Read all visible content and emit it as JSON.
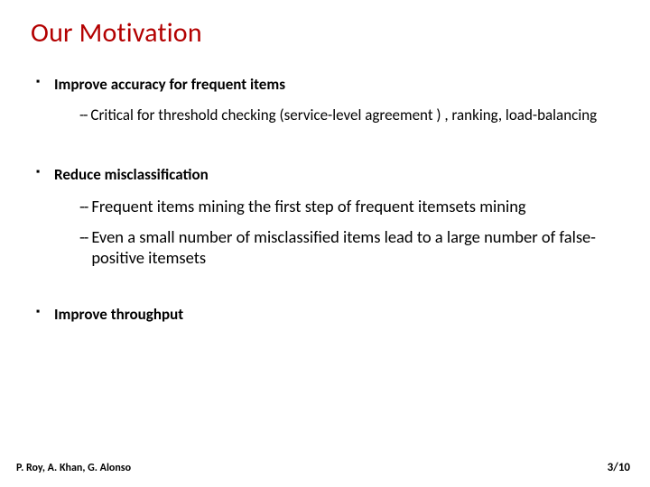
{
  "title": "Our Motivation",
  "bullets": [
    {
      "head": "Improve accuracy for frequent items",
      "subs": [
        "Critical for threshold checking (service-level agreement ) , ranking, load-balancing"
      ]
    },
    {
      "head": "Reduce misclassification",
      "subs": [
        "Frequent items mining the first step of frequent itemsets mining",
        "Even a small number of misclassified items lead to a large number of false-positive itemsets"
      ]
    },
    {
      "head": "Improve throughput",
      "subs": []
    }
  ],
  "footer": {
    "authors": "P. Roy, A. Khan, G. Alonso",
    "page": "3/10"
  }
}
